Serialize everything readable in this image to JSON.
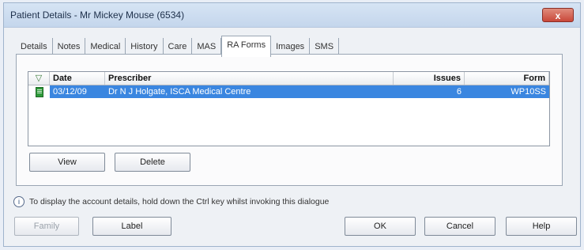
{
  "window": {
    "title": "Patient Details - Mr Mickey Mouse (6534)",
    "close_label": "x"
  },
  "tabs": [
    {
      "label": "Details"
    },
    {
      "label": "Notes"
    },
    {
      "label": "Medical"
    },
    {
      "label": "History"
    },
    {
      "label": "Care"
    },
    {
      "label": "MAS"
    },
    {
      "label": "RA Forms"
    },
    {
      "label": "Images"
    },
    {
      "label": "SMS"
    }
  ],
  "active_tab": "RA Forms",
  "grid": {
    "columns": {
      "filter": "▽",
      "date": "Date",
      "prescriber": "Prescriber",
      "issues": "Issues",
      "form": "Form"
    },
    "rows": [
      {
        "date": "03/12/09",
        "prescriber": "Dr N J Holgate, ISCA Medical Centre",
        "issues": "6",
        "form": "WP10SS"
      }
    ]
  },
  "panel_buttons": {
    "view": "View",
    "delete": "Delete"
  },
  "info": {
    "text": "To display the account details, hold down the Ctrl key whilst invoking this dialogue"
  },
  "footer_buttons": {
    "family": "Family",
    "label": "Label",
    "ok": "OK",
    "cancel": "Cancel",
    "help": "Help"
  },
  "colors": {
    "selection": "#3a86e0",
    "title_bar": "#c4d6ec",
    "close": "#c9483a"
  }
}
